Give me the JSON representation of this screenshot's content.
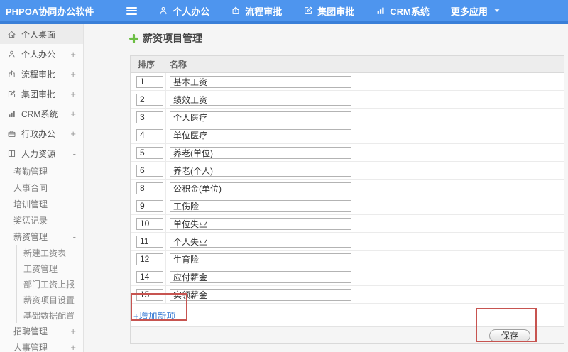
{
  "header": {
    "logo": "PHPOA协同办公软件",
    "nav": [
      {
        "label": "个人办公",
        "icon": "user-icon"
      },
      {
        "label": "流程审批",
        "icon": "flow-icon"
      },
      {
        "label": "集团审批",
        "icon": "edit-icon"
      },
      {
        "label": "CRM系统",
        "icon": "chart-icon"
      },
      {
        "label": "更多应用",
        "trailing": "caret-down-icon"
      }
    ]
  },
  "sidebar": {
    "items": [
      {
        "label": "个人桌面",
        "icon": "home-icon",
        "active": true
      },
      {
        "label": "个人办公",
        "icon": "user-icon",
        "expand": "+"
      },
      {
        "label": "流程审批",
        "icon": "flow-icon",
        "expand": "+"
      },
      {
        "label": "集团审批",
        "icon": "edit-icon",
        "expand": "+"
      },
      {
        "label": "CRM系统",
        "icon": "chart-icon",
        "expand": "+"
      },
      {
        "label": "行政办公",
        "icon": "briefcase-icon",
        "expand": "+"
      },
      {
        "label": "人力资源",
        "icon": "book-icon",
        "expand": "-",
        "children": [
          {
            "label": "考勤管理"
          },
          {
            "label": "人事合同"
          },
          {
            "label": "培训管理"
          },
          {
            "label": "奖惩记录"
          },
          {
            "label": "薪资管理",
            "expand": "-",
            "children": [
              {
                "label": "新建工资表"
              },
              {
                "label": "工资管理"
              },
              {
                "label": "部门工资上报"
              },
              {
                "label": "薪资项目设置"
              },
              {
                "label": "基础数据配置"
              }
            ]
          },
          {
            "label": "招聘管理",
            "expand": "+"
          },
          {
            "label": "人事管理",
            "expand": "+"
          }
        ]
      }
    ]
  },
  "main": {
    "title": "薪资项目管理",
    "table": {
      "headers": [
        "排序",
        "名称"
      ],
      "rows": [
        {
          "order": "1",
          "name": "基本工资"
        },
        {
          "order": "2",
          "name": "绩效工资"
        },
        {
          "order": "3",
          "name": "个人医疗"
        },
        {
          "order": "4",
          "name": "单位医疗"
        },
        {
          "order": "5",
          "name": "养老(单位)"
        },
        {
          "order": "6",
          "name": "养老(个人)"
        },
        {
          "order": "8",
          "name": "公积金(单位)"
        },
        {
          "order": "9",
          "name": "工伤险"
        },
        {
          "order": "10",
          "name": "单位失业"
        },
        {
          "order": "11",
          "name": "个人失业"
        },
        {
          "order": "12",
          "name": "生育险"
        },
        {
          "order": "14",
          "name": "应付薪金"
        },
        {
          "order": "15",
          "name": "实领薪金"
        }
      ]
    },
    "add_link": "+增加新项",
    "save_label": "保存"
  },
  "colors": {
    "header_blue": "#4E95EE",
    "header_blue_dark": "#3A7FD8",
    "link_blue": "#3E7FD6",
    "annotation_red": "#C75450",
    "plus_green": "#6CBE44"
  }
}
